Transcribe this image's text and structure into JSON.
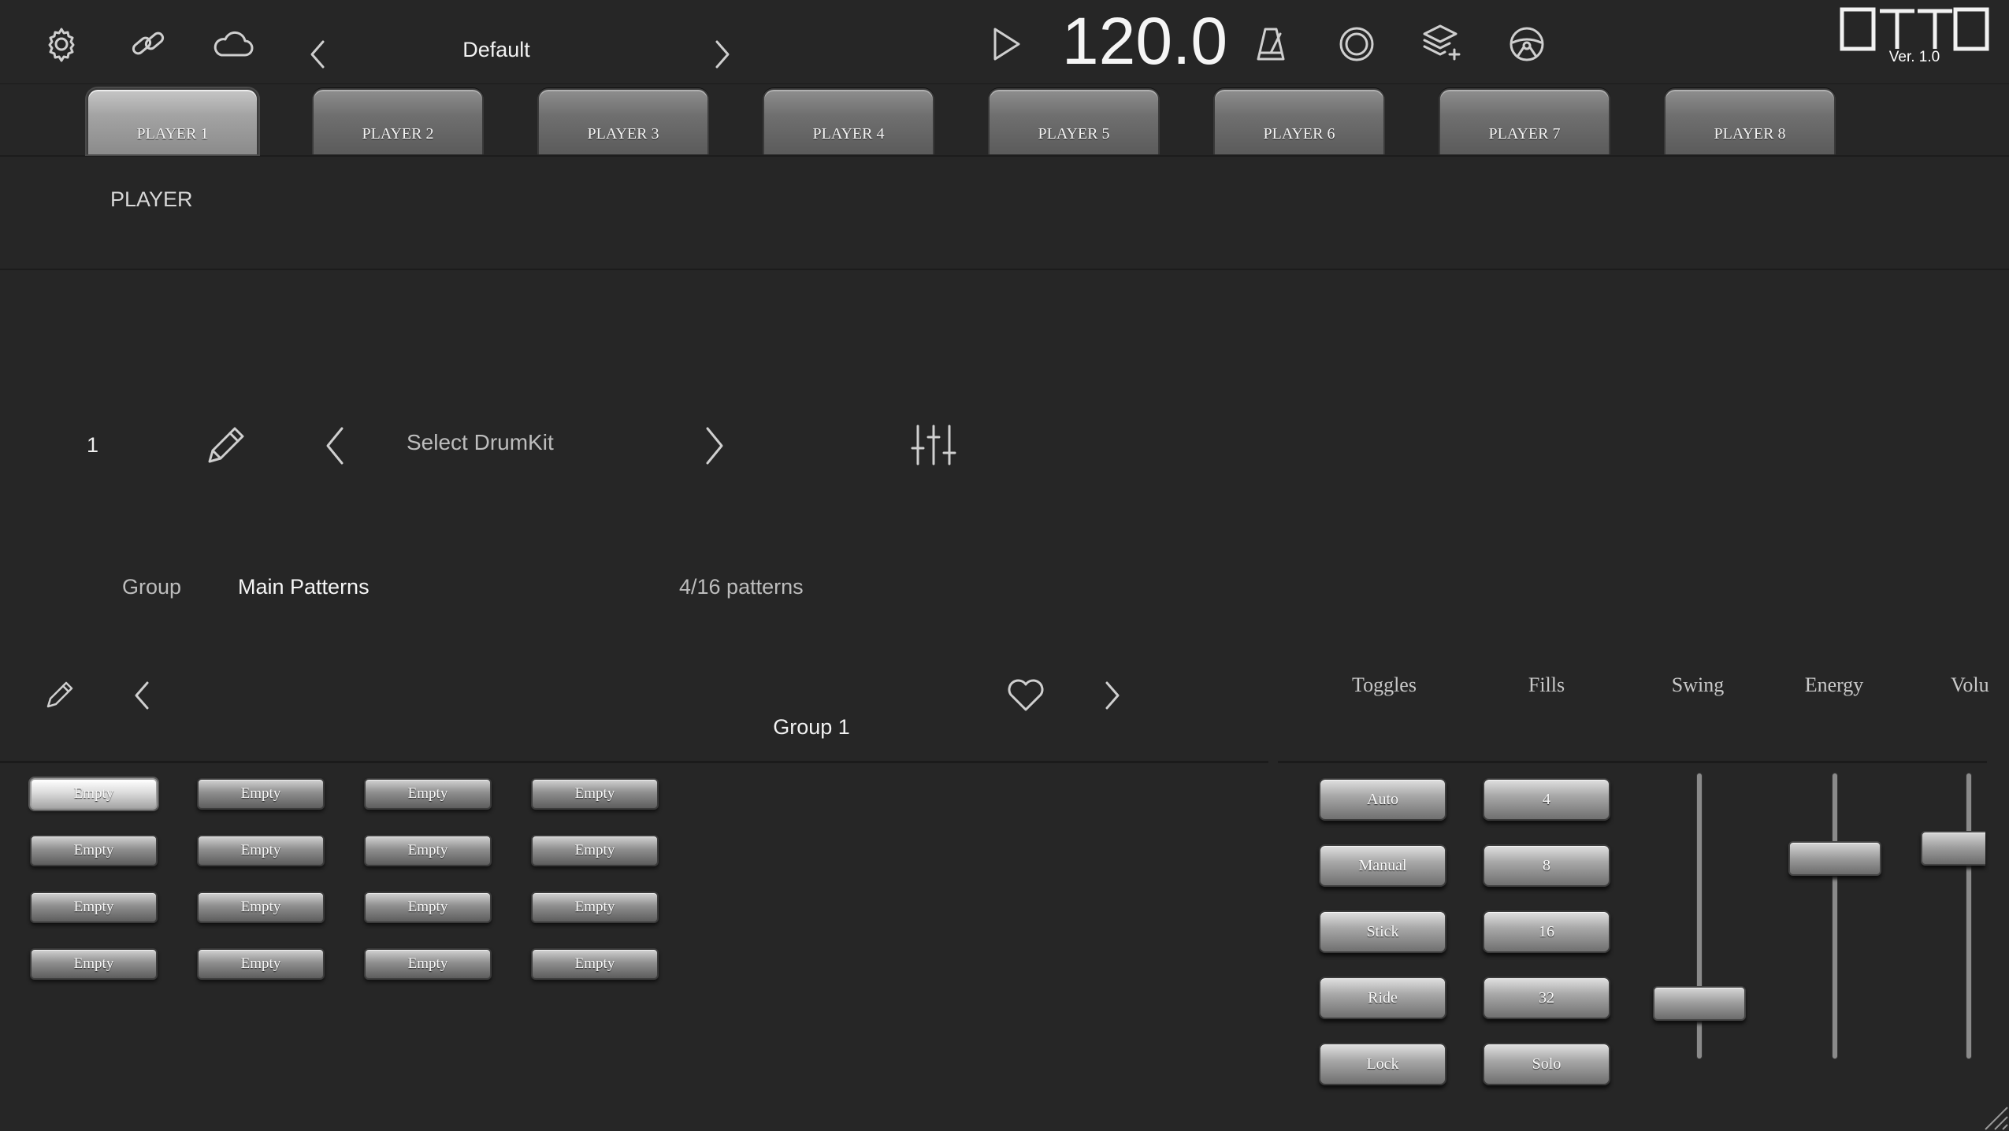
{
  "header": {
    "preset_name": "Default",
    "tempo": "120.0",
    "version": "Ver. 1.0",
    "icons": [
      "gear-icon",
      "link-icon",
      "cloud-icon",
      "chevron-left-icon",
      "chevron-right-icon",
      "play-icon",
      "metronome-icon",
      "record-icon",
      "layers-add-icon",
      "steering-wheel-icon"
    ],
    "logo_text": "OTTO"
  },
  "players": {
    "tabs": [
      "PLAYER 1",
      "PLAYER 2",
      "PLAYER 3",
      "PLAYER 4",
      "PLAYER 5",
      "PLAYER 6",
      "PLAYER 7",
      "PLAYER 8"
    ],
    "active": 0
  },
  "player_section": {
    "label": "PLAYER"
  },
  "kit": {
    "number": "1",
    "name": "Select DrumKit"
  },
  "patterns": {
    "group_label": "Group",
    "group_value": "Main Patterns",
    "count": "4/16 patterns",
    "group_name": "Group 1",
    "cells": [
      "Empty",
      "Empty",
      "Empty",
      "Empty",
      "Empty",
      "Empty",
      "Empty",
      "Empty",
      "Empty",
      "Empty",
      "Empty",
      "Empty",
      "Empty",
      "Empty",
      "Empty",
      "Empty"
    ],
    "selected_index": 0
  },
  "controls": {
    "headers": {
      "toggles": "Toggles",
      "fills": "Fills",
      "swing": "Swing",
      "energy": "Energy",
      "volume": "Volu"
    },
    "toggles": [
      "Auto",
      "Manual",
      "Stick",
      "Ride",
      "Lock"
    ],
    "fills": [
      "4",
      "8",
      "16",
      "32",
      "Solo"
    ],
    "sliders": {
      "swing": 0.15,
      "energy": 0.73,
      "volume": 0.77
    }
  },
  "colors": {
    "background": "#262626",
    "text_primary": "#f2f2f2",
    "text_secondary": "#bdbdbd"
  }
}
